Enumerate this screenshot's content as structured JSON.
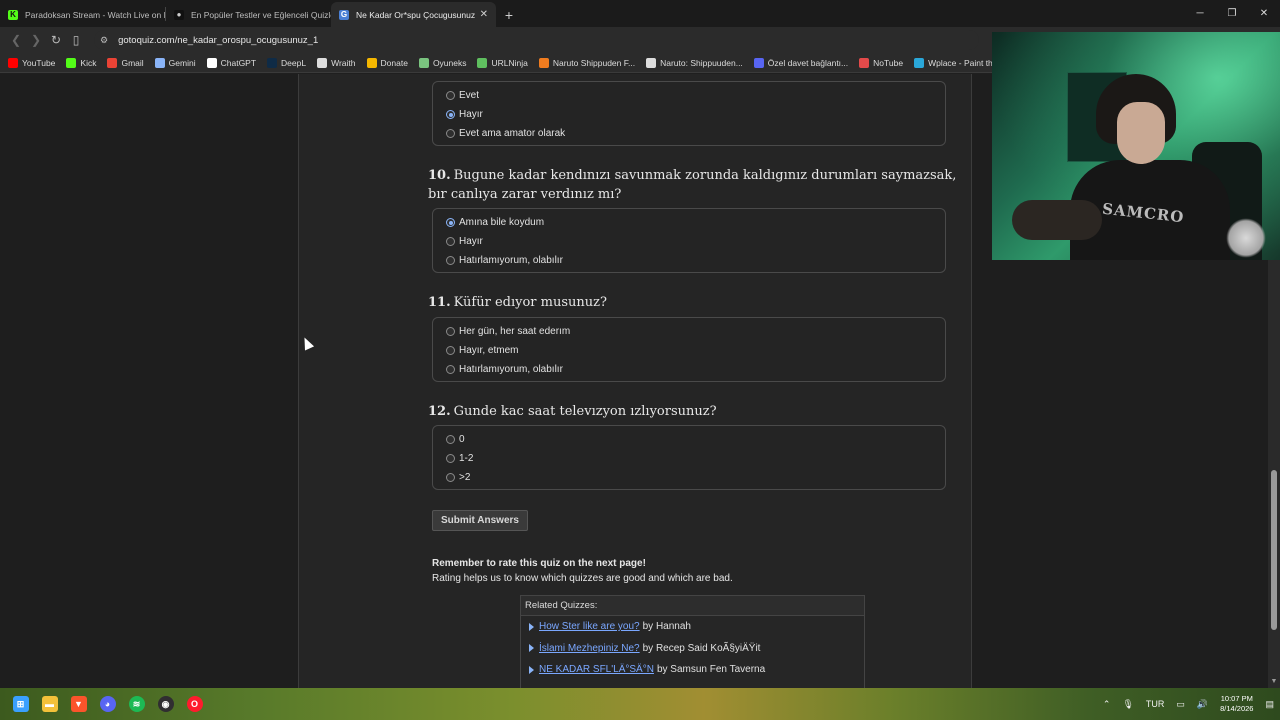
{
  "browser": {
    "tabs": [
      {
        "title": "Paradoksan Stream - Watch Live on K",
        "favicon": "kick-icon",
        "color": "#53fc18",
        "active": false
      },
      {
        "title": "En Popüler Testler ve Eğlenceli Quizle",
        "favicon": "quiz-icon",
        "color": "#111111",
        "active": false
      },
      {
        "title": "Ne Kadar Or*spu Çocugusunuz",
        "favicon": "gotoquiz-icon",
        "color": "#4a7fd4",
        "active": true
      }
    ],
    "url": "gotoquiz.com/ne_kadar_orospu_ocugusunuz_1",
    "bookmarks": [
      {
        "label": "YouTube",
        "color": "#ff0000"
      },
      {
        "label": "Kick",
        "color": "#53fc18"
      },
      {
        "label": "Gmail",
        "color": "#ea4335"
      },
      {
        "label": "Gemini",
        "color": "#8ab4f8"
      },
      {
        "label": "ChatGPT",
        "color": "#ffffff"
      },
      {
        "label": "DeepL",
        "color": "#0f2b46"
      },
      {
        "label": "Wraith",
        "color": "#dddddd"
      },
      {
        "label": "Donate",
        "color": "#f5b700"
      },
      {
        "label": "Oyuneks",
        "color": "#7ac47f"
      },
      {
        "label": "URLNinja",
        "color": "#5fbf5f"
      },
      {
        "label": "Naruto Shippuden F...",
        "color": "#f07c1f"
      },
      {
        "label": "Naruto: Shippuuden...",
        "color": "#dddddd"
      },
      {
        "label": "Özel davet bağlantı...",
        "color": "#5865f2"
      },
      {
        "label": "NoTube",
        "color": "#e34a4a"
      },
      {
        "label": "Wplace - Paint the...",
        "color": "#2aa7d9"
      }
    ]
  },
  "quiz": {
    "q9_options": [
      {
        "label": "Evet",
        "checked": false
      },
      {
        "label": "Hayır",
        "checked": true
      },
      {
        "label": "Evet ama amator olarak",
        "checked": false
      }
    ],
    "q10": {
      "number": "10.",
      "text": "Bugune kadar kendınızı savunmak zorunda kaldıgınız durumları saymazsak, bır canlıya zarar verdınız mı?",
      "options": [
        {
          "label": "Amına bile koydum",
          "checked": true
        },
        {
          "label": "Hayır",
          "checked": false
        },
        {
          "label": "Hatırlamıyorum, olabılır",
          "checked": false
        }
      ]
    },
    "q11": {
      "number": "11.",
      "text": "Küfür edıyor musunuz?",
      "options": [
        {
          "label": "Her gün, her saat ederım",
          "checked": false
        },
        {
          "label": "Hayır, etmem",
          "checked": false
        },
        {
          "label": "Hatırlamıyorum, olabılır",
          "checked": false
        }
      ]
    },
    "q12": {
      "number": "12.",
      "text": "Gunde kac saat televızyon ızlıyorsunuz?",
      "options": [
        {
          "label": "0",
          "checked": false
        },
        {
          "label": "1-2",
          "checked": false
        },
        {
          "label": ">2",
          "checked": false
        }
      ]
    },
    "submit_label": "Submit Answers",
    "remember_bold": "Remember to rate this quiz on the next page!",
    "remember_text": "Rating helps us to know which quizzes are good and which are bad.",
    "related_header": "Related Quizzes:",
    "related": [
      {
        "title": "How Ster like are you?",
        "by": "by Hannah"
      },
      {
        "title": "İslami Mezhepiniz Ne?",
        "by": "by Recep Said KoÃ§yiÄŸit"
      },
      {
        "title": "NE KADAR SFL'LÄ°SÄ°N",
        "by": "by Samsun Fen Taverna"
      }
    ]
  },
  "webcam": {
    "shirt_text": "SAMCRO"
  },
  "taskbar": {
    "apps": [
      {
        "name": "windows-start-icon",
        "color": "#3aa0ff"
      },
      {
        "name": "file-explorer-icon",
        "color": "#f3c13a"
      },
      {
        "name": "brave-icon",
        "color": "#fb542b"
      },
      {
        "name": "discord-icon",
        "color": "#5865f2"
      },
      {
        "name": "spotify-icon",
        "color": "#1db954"
      },
      {
        "name": "obs-icon",
        "color": "#302e31"
      },
      {
        "name": "opera-icon",
        "color": "#ff1b2d"
      }
    ],
    "language": "TUR",
    "time": "10:07 PM",
    "date": "8/14/2026"
  }
}
